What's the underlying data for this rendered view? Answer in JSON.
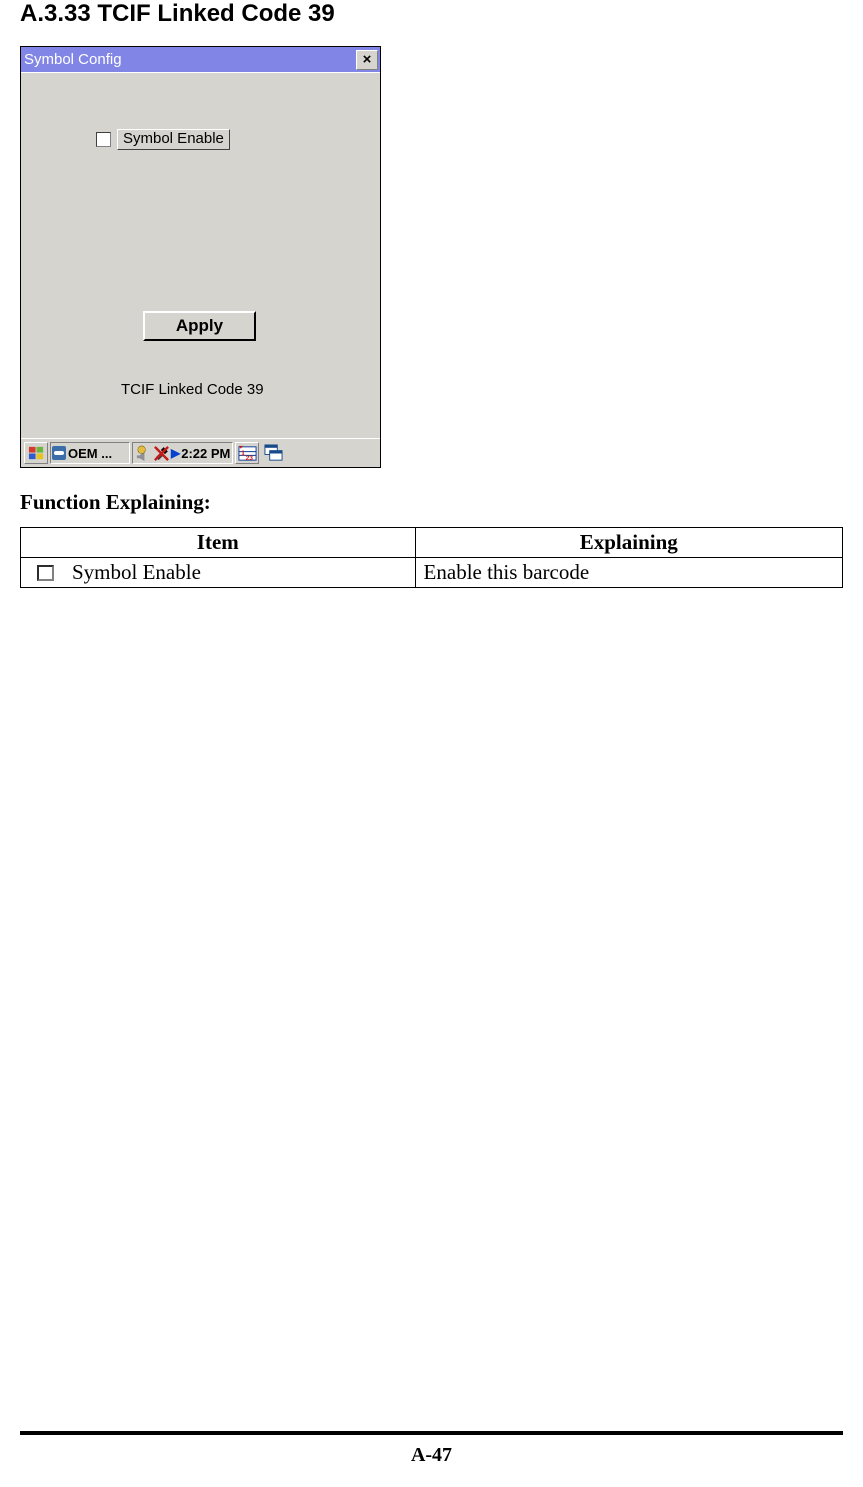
{
  "heading": "A.3.33 TCIF Linked Code 39",
  "window": {
    "title": "Symbol Config",
    "close_symbol": "×",
    "checkbox_label": "Symbol Enable",
    "apply_label": "Apply",
    "status_text": "TCIF Linked Code 39"
  },
  "taskbar": {
    "oem_text": "OEM ...",
    "clock": "2:22 PM"
  },
  "section_heading": "Function Explaining:",
  "table": {
    "header_item": "Item",
    "header_explaining": "Explaining",
    "row1_item": "Symbol Enable",
    "row1_explain": "Enable this barcode"
  },
  "footer_page": "A-47"
}
